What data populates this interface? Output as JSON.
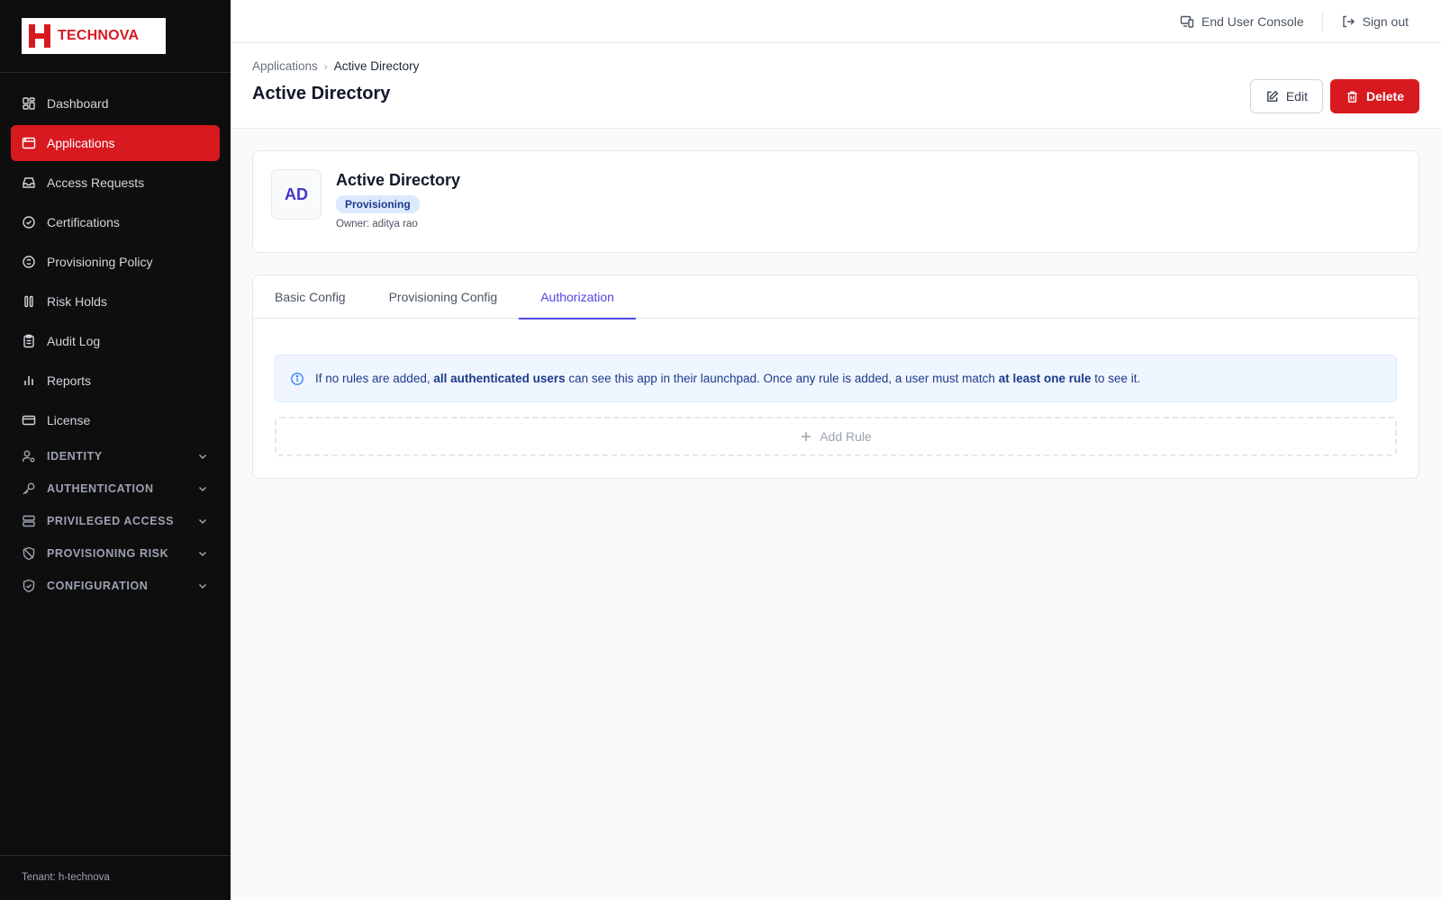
{
  "brand": {
    "name": "TECHNOVA",
    "color": "#d71920"
  },
  "sidebar": {
    "items": [
      {
        "label": "Dashboard",
        "icon": "dashboard-icon"
      },
      {
        "label": "Applications",
        "icon": "applications-icon",
        "active": true
      },
      {
        "label": "Access Requests",
        "icon": "inbox-icon"
      },
      {
        "label": "Certifications",
        "icon": "check-circle-icon"
      },
      {
        "label": "Provisioning Policy",
        "icon": "policy-icon"
      },
      {
        "label": "Risk Holds",
        "icon": "pause-icon"
      },
      {
        "label": "Audit Log",
        "icon": "clipboard-icon"
      },
      {
        "label": "Reports",
        "icon": "bar-chart-icon"
      },
      {
        "label": "License",
        "icon": "card-icon"
      }
    ],
    "groups": [
      {
        "label": "IDENTITY",
        "icon": "user-gear-icon"
      },
      {
        "label": "AUTHENTICATION",
        "icon": "key-icon"
      },
      {
        "label": "PRIVILEGED ACCESS",
        "icon": "server-icon"
      },
      {
        "label": "PROVISIONING RISK",
        "icon": "shield-off-icon"
      },
      {
        "label": "CONFIGURATION",
        "icon": "shield-check-icon"
      }
    ],
    "tenant": "Tenant: h-technova"
  },
  "topbar": {
    "end_user_console": "End User Console",
    "sign_out": "Sign out"
  },
  "header": {
    "breadcrumb": {
      "parent": "Applications",
      "current": "Active Directory"
    },
    "title": "Active Directory",
    "edit_label": "Edit",
    "delete_label": "Delete"
  },
  "app": {
    "initials": "AD",
    "name": "Active Directory",
    "badge": "Provisioning",
    "owner": "Owner: aditya rao"
  },
  "tabs": [
    {
      "label": "Basic Config"
    },
    {
      "label": "Provisioning Config"
    },
    {
      "label": "Authorization",
      "active": true
    }
  ],
  "info": {
    "part1": "If no rules are added, ",
    "bold1": "all authenticated users",
    "part2": " can see this app in their launchpad. Once any rule is added, a user must match ",
    "bold2": "at least one rule",
    "part3": " to see it."
  },
  "add_rule_label": "Add Rule"
}
